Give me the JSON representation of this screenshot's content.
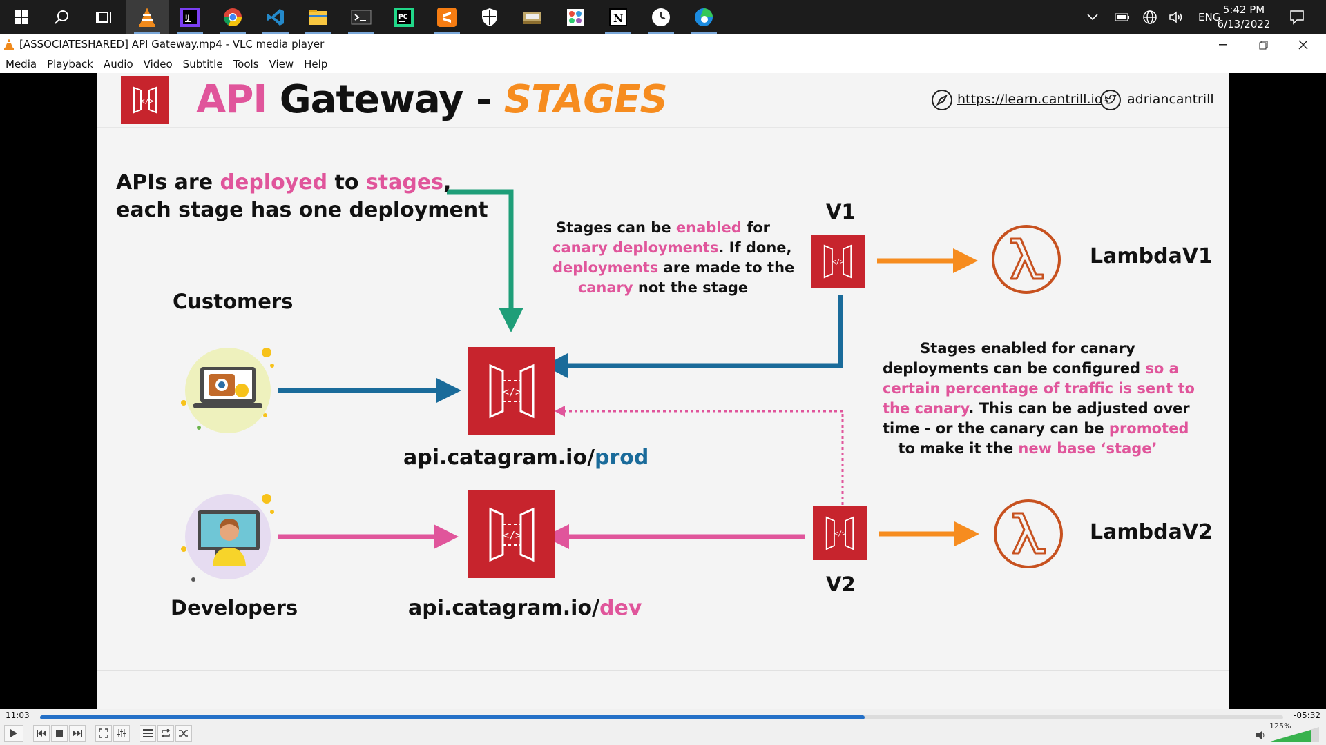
{
  "taskbar": {
    "icons": [
      "windows-start-icon",
      "search-icon",
      "task-view-icon",
      "vlc-icon",
      "intellij-icon",
      "chrome-icon",
      "vscode-icon",
      "file-explorer-icon",
      "terminal-icon",
      "pycharm-icon",
      "sublime-icon",
      "security-icon",
      "app-icon",
      "paint-icon",
      "notion-icon",
      "clock-app-icon",
      "edge-icon"
    ],
    "lang": "ENG",
    "time": "5:42 PM",
    "date": "6/13/2022"
  },
  "window": {
    "title": "[ASSOCIATESHARED] API Gateway.mp4 - VLC media player"
  },
  "menu": [
    "Media",
    "Playback",
    "Audio",
    "Video",
    "Subtitle",
    "Tools",
    "View",
    "Help"
  ],
  "slide": {
    "title_part1": "API",
    "title_part2": " Gateway - ",
    "title_part3": "STAGES",
    "link": "https://learn.cantrill.io",
    "twitter": "adriancantrill",
    "intro_line1_a": "APIs are ",
    "intro_line1_b": "deployed",
    "intro_line1_c": " to ",
    "intro_line1_d": "stages",
    "intro_line1_e": ",",
    "intro_line2": "each stage has one deployment",
    "canary_a": "Stages can be ",
    "canary_b": "enabled",
    "canary_c": " for",
    "canary_d": "canary deployments",
    "canary_e": ". If done,",
    "canary_f": "deployments",
    "canary_g": " are made to the",
    "canary_h": "canary",
    "canary_i": " not the stage",
    "customers": "Customers",
    "developers": "Developers",
    "prod_base": "api.catagram.io/",
    "prod_stage": "prod",
    "dev_base": "api.catagram.io/",
    "dev_stage": "dev",
    "v1": "V1",
    "v2": "V2",
    "lambda1": "LambdaV1",
    "lambda2": "LambdaV2",
    "right_1": "Stages enabled for canary",
    "right_2a": "deployments can be configured ",
    "right_2b": "so a",
    "right_3": "certain percentage of traffic is sent to",
    "right_4a": "the canary",
    "right_4b": ". This can be adjusted over",
    "right_5a": "time - or the canary can be ",
    "right_5b": "promoted",
    "right_6a": "to make it the ",
    "right_6b": "new base ‘stage’"
  },
  "player": {
    "elapsed": "11:03",
    "remaining": "-05:32",
    "progress": 0.6636,
    "volume": "125%"
  },
  "colors": {
    "pink": "#e0559b",
    "blue": "#1a6b9a",
    "green": "#1e9e78",
    "orange": "#f68c1f",
    "aws_red": "#c7242d"
  }
}
